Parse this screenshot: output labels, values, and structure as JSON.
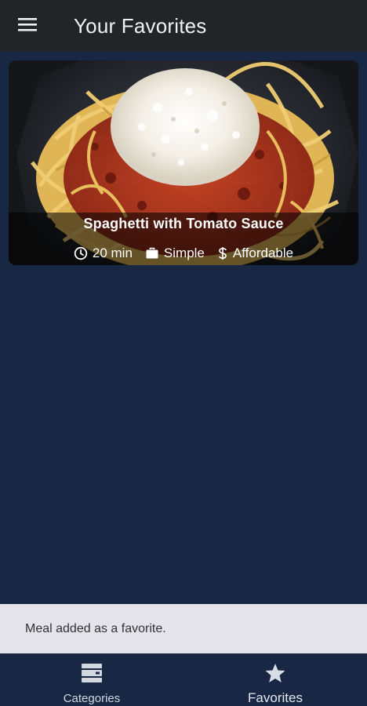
{
  "app_bar": {
    "title": "Your Favorites",
    "menu_icon": "menu-icon"
  },
  "meal": {
    "title": "Spaghetti with Tomato Sauce",
    "duration": "20 min",
    "complexity": "Simple",
    "affordability": "Affordable",
    "icons": {
      "duration": "clock-icon",
      "complexity": "briefcase-icon",
      "affordability": "dollar-icon"
    }
  },
  "snackbar": {
    "message": "Meal added as a favorite."
  },
  "bottom_nav": {
    "items": [
      {
        "label": "Categories",
        "icon": "categories-icon",
        "active": false
      },
      {
        "label": "Favorites",
        "icon": "star-icon",
        "active": true
      }
    ]
  },
  "colors": {
    "background": "#172744",
    "app_bar": "#222428",
    "snackbar": "#e4e4ea",
    "text_light": "#ffffff"
  }
}
